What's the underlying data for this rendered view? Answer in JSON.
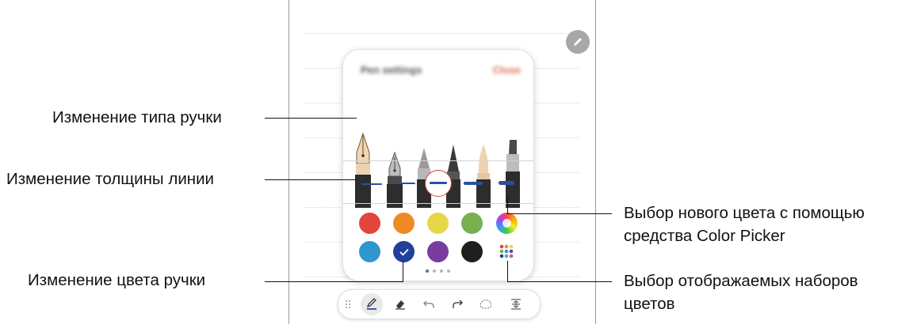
{
  "panel": {
    "title": "Pen settings",
    "close_label": "Close",
    "pen_types": [
      "fountain-pen",
      "calligraphy-pen",
      "pen",
      "pencil",
      "brush",
      "highlighter"
    ],
    "selected_pen": "fountain-pen",
    "line_thickness": {
      "levels": 5,
      "selected_index": 3
    },
    "colors_row1": [
      "#e2453b",
      "#ef8a27",
      "#e6d64a",
      "#77b04f",
      "color-picker-icon"
    ],
    "colors_row2": [
      "#2f96d0",
      "#213f9c",
      "#7a3ba1",
      "#1f1f1f",
      "palette-sets-icon"
    ],
    "selected_color": "#213f9c",
    "page_indicator": {
      "pages": 4,
      "current": 1
    }
  },
  "toolbar": {
    "items": [
      "drag-handle-icon",
      "pen-icon",
      "eraser-icon",
      "undo-icon",
      "redo-icon",
      "selection-icon",
      "insert-space-icon"
    ],
    "active": "pen-icon"
  },
  "callouts": {
    "pen_type": "Изменение типа ручки",
    "line_thickness": "Изменение толщины линии",
    "pen_color": "Изменение цвета ручки",
    "color_picker_line1": "Выбор нового цвета с помощью",
    "color_picker_line2": "средства Color Picker",
    "color_sets_line1": "Выбор отображаемых наборов",
    "color_sets_line2": "цветов"
  }
}
